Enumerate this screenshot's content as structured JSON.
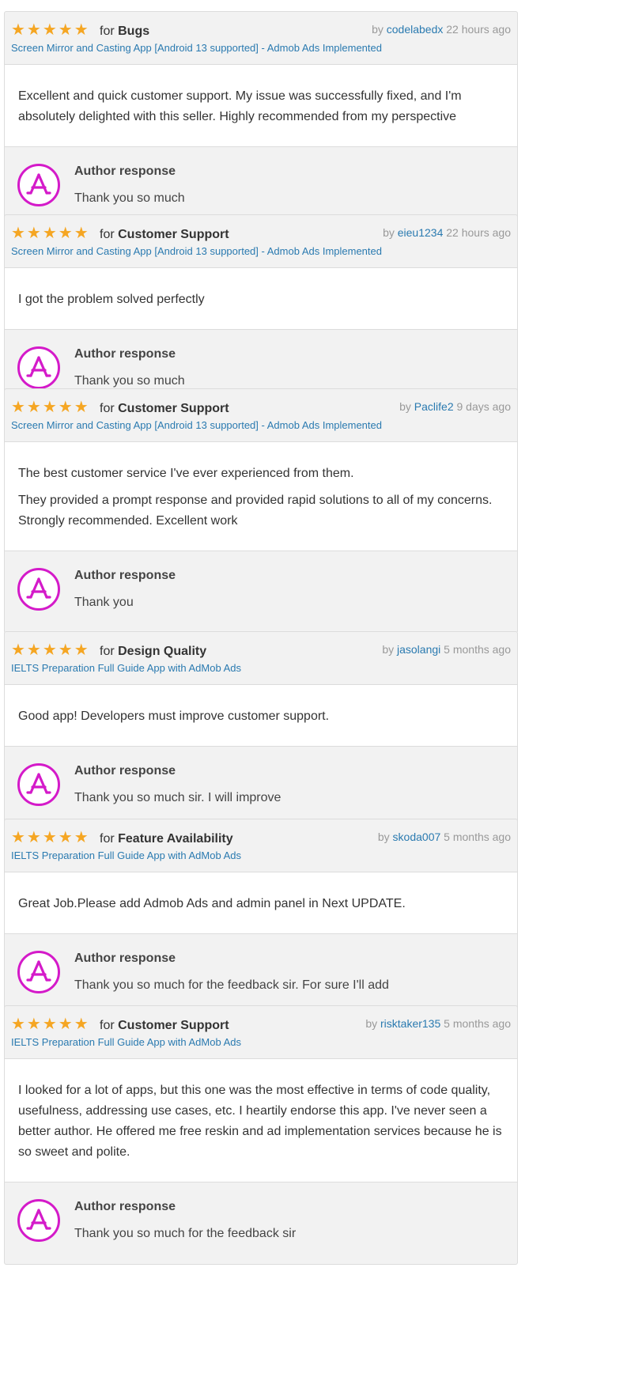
{
  "reviews": [
    {
      "rating": 5,
      "stars": "★★★★★",
      "for_prefix": "for",
      "category": "Bugs",
      "by_prefix": "by",
      "author": "codelabedx",
      "time": "22 hours ago",
      "item": "Screen Mirror and Casting App [Android 13 supported] - Admob Ads Implemented",
      "body": [
        "Excellent and quick customer support. My issue was successfully fixed, and I'm absolutely delighted with this seller. Highly recommended from my perspective"
      ],
      "response_title": "Author response",
      "response": "Thank you so much"
    },
    {
      "rating": 5,
      "stars": "★★★★★",
      "for_prefix": "for",
      "category": "Customer Support",
      "by_prefix": "by",
      "author": "eieu1234",
      "time": "22 hours ago",
      "item": "Screen Mirror and Casting App [Android 13 supported] - Admob Ads Implemented",
      "body": [
        "I got the problem solved perfectly"
      ],
      "response_title": "Author response",
      "response": "Thank you so much"
    },
    {
      "rating": 5,
      "stars": "★★★★★",
      "for_prefix": "for",
      "category": "Customer Support",
      "by_prefix": "by",
      "author": "Paclife2",
      "time": "9 days ago",
      "item": "Screen Mirror and Casting App [Android 13 supported] - Admob Ads Implemented",
      "body": [
        "The best customer service I've ever experienced from them.",
        "They provided a prompt response and provided rapid solutions to all of my concerns.\nStrongly recommended. Excellent work"
      ],
      "response_title": "Author response",
      "response": "Thank you"
    },
    {
      "rating": 5,
      "stars": "★★★★★",
      "for_prefix": "for",
      "category": "Design Quality",
      "by_prefix": "by",
      "author": "jasolangi",
      "time": "5 months ago",
      "item": "IELTS Preparation Full Guide App with AdMob Ads",
      "body": [
        "Good app! Developers must improve customer support."
      ],
      "response_title": "Author response",
      "response": "Thank you so much sir. I will improve"
    },
    {
      "rating": 5,
      "stars": "★★★★★",
      "for_prefix": "for",
      "category": "Feature Availability",
      "by_prefix": "by",
      "author": "skoda007",
      "time": "5 months ago",
      "item": "IELTS Preparation Full Guide App with AdMob Ads",
      "body": [
        "Great Job.Please add Admob Ads and admin panel in Next UPDATE."
      ],
      "response_title": "Author response",
      "response": "Thank you so much for the feedback sir. For sure I'll add"
    },
    {
      "rating": 5,
      "stars": "★★★★★",
      "for_prefix": "for",
      "category": "Customer Support",
      "by_prefix": "by",
      "author": "risktaker135",
      "time": "5 months ago",
      "item": "IELTS Preparation Full Guide App with AdMob Ads",
      "body": [
        "I looked for a lot of apps, but this one was the most effective in terms of code quality, usefulness, addressing use cases, etc. I heartily endorse this app. I've never seen a better author. He offered me free reskin and ad implementation services because he is so sweet and polite."
      ],
      "response_title": "Author response",
      "response": "Thank you so much for the feedback sir"
    }
  ],
  "colors": {
    "star": "#f5a623",
    "link": "#2a7ab0",
    "avatar_ring": "#d41ac9",
    "panel_bg": "#f2f2f2"
  },
  "icons": {
    "avatar": "app-store-logo-icon",
    "star": "star-icon"
  }
}
